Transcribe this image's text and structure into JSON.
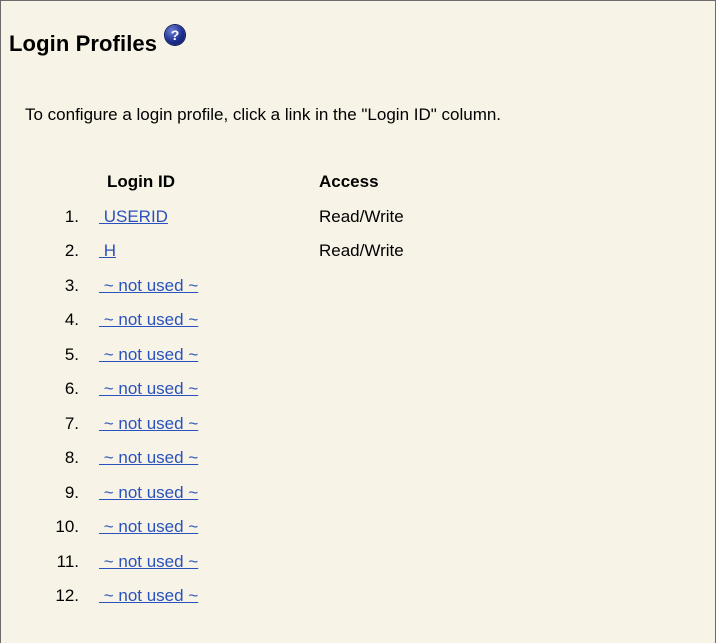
{
  "page": {
    "title": "Login Profiles",
    "help_icon": "question-icon",
    "instruction": "To configure a login profile, click a link in the \"Login ID\" column."
  },
  "table": {
    "headers": {
      "login_id": "Login ID",
      "access": "Access"
    },
    "rows": [
      {
        "num": "1.",
        "login_id": " USERID",
        "access": "Read/Write"
      },
      {
        "num": "2.",
        "login_id": " H",
        "access": "Read/Write"
      },
      {
        "num": "3.",
        "login_id": " ~ not used ~",
        "access": ""
      },
      {
        "num": "4.",
        "login_id": " ~ not used ~",
        "access": ""
      },
      {
        "num": "5.",
        "login_id": " ~ not used ~",
        "access": ""
      },
      {
        "num": "6.",
        "login_id": " ~ not used ~",
        "access": ""
      },
      {
        "num": "7.",
        "login_id": " ~ not used ~",
        "access": ""
      },
      {
        "num": "8.",
        "login_id": " ~ not used ~",
        "access": ""
      },
      {
        "num": "9.",
        "login_id": " ~ not used ~",
        "access": ""
      },
      {
        "num": "10.",
        "login_id": " ~ not used ~",
        "access": ""
      },
      {
        "num": "11.",
        "login_id": " ~ not used ~",
        "access": ""
      },
      {
        "num": "12.",
        "login_id": " ~ not used ~",
        "access": ""
      }
    ]
  },
  "colors": {
    "background": "#f7f3e6",
    "link": "#2a52be",
    "help_icon": "#1d2f8f"
  }
}
